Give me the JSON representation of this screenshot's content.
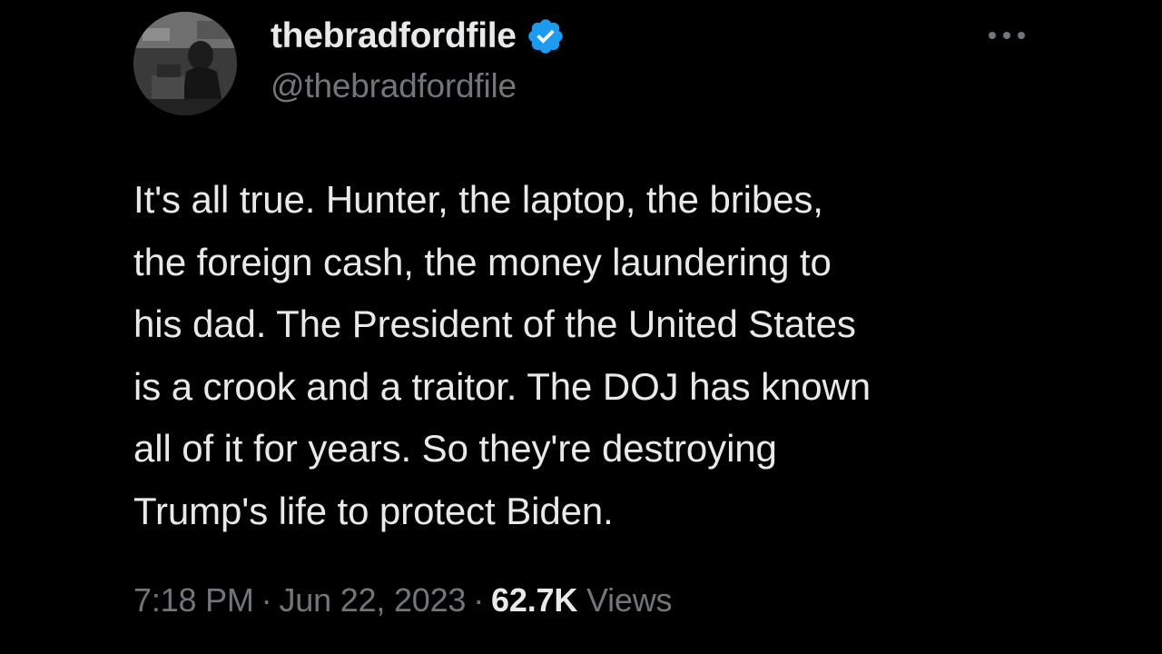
{
  "author": {
    "display_name": "thebradfordfile",
    "handle": "@thebradfordfile",
    "verified_icon": "verified-badge-icon",
    "verified_color": "#1d9bf0"
  },
  "more_icon": "more-options-icon",
  "tweet": {
    "lines": [
      "It's all true. Hunter, the laptop, the bribes,",
      "the foreign cash, the money laundering to",
      "his dad. The President of the United States",
      "is a crook and a traitor. The DOJ has known",
      "all of it for years. So they're destroying",
      "Trump's life to protect Biden."
    ]
  },
  "meta": {
    "time": "7:18 PM",
    "separator": "·",
    "date": "Jun 22, 2023",
    "views_count": "62.7K",
    "views_label": "Views"
  },
  "colors": {
    "background": "#000000",
    "primary_text": "#e7e9ea",
    "secondary_text": "#71767b"
  }
}
